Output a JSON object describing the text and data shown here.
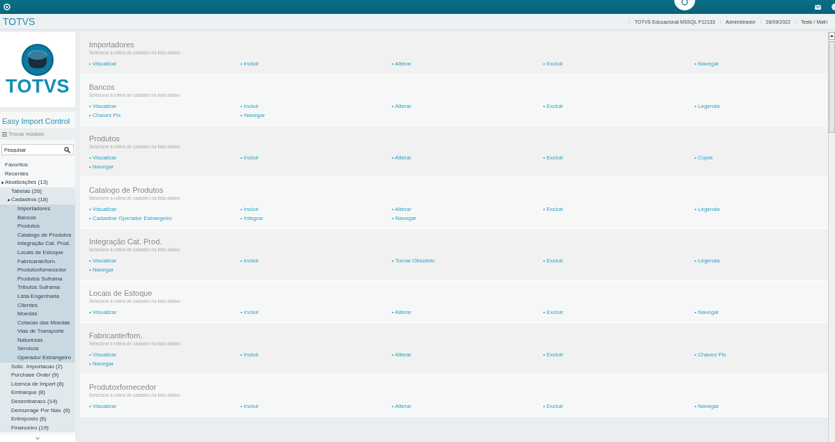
{
  "header": {
    "title": "TOTVS",
    "info": [
      "TOTVS Educacional MSSQL P12133",
      "Administrador",
      "26/09/2022",
      "Teste / Matri"
    ]
  },
  "sidebar": {
    "logo_text": "TOTVS",
    "module": "Easy Import Control",
    "switch_module": "Trocar módulo",
    "search": {
      "placeholder": "Pesquisar"
    },
    "tree": [
      {
        "label": "Favoritos"
      },
      {
        "label": "Recentes"
      },
      {
        "label": "Atualizações (13)",
        "expanded": true,
        "children": [
          {
            "label": "Tabelas (26)"
          },
          {
            "label": "Cadastros (18)",
            "expanded": true,
            "children": [
              {
                "label": "Importadores"
              },
              {
                "label": "Bancos"
              },
              {
                "label": "Produtos"
              },
              {
                "label": "Catalogo de Produtos"
              },
              {
                "label": "Integração Cat. Prod."
              },
              {
                "label": "Locais de Estoque"
              },
              {
                "label": "Fabricante/forn."
              },
              {
                "label": "Produtoxfornecedor"
              },
              {
                "label": "Produtos Suframa"
              },
              {
                "label": "Tributos Suframa"
              },
              {
                "label": "Lista Engenharia"
              },
              {
                "label": "Clientes"
              },
              {
                "label": "Moedas"
              },
              {
                "label": "Cotacao das Moedas"
              },
              {
                "label": "Vias de Transporte"
              },
              {
                "label": "Naturezas"
              },
              {
                "label": "Servicos"
              },
              {
                "label": "Operador Estrangeiro"
              }
            ]
          },
          {
            "label": "Solic. Importacao (2)"
          },
          {
            "label": "Purchase Order (9)"
          },
          {
            "label": "Licenca de Import (8)"
          },
          {
            "label": "Embarque (8)"
          },
          {
            "label": "Desembaraco (14)"
          },
          {
            "label": "Demurrage Por Nav. (6)"
          },
          {
            "label": "Entreposto (6)"
          },
          {
            "label": "Financeiro (19)"
          }
        ]
      }
    ]
  },
  "sections": [
    {
      "title": "Importadores",
      "subtitle": "Selecione a rotina de cadastro na lista abaixo",
      "links": [
        "• Visualizar",
        "• Incluir",
        "• Alterar",
        "• Excluir",
        "• Navegar"
      ]
    },
    {
      "title": "Bancos",
      "subtitle": "Selecione a rotina de cadastro na lista abaixo",
      "links": [
        "• Visualizar",
        "• Incluir",
        "• Alterar",
        "• Excluir",
        "• Legenda",
        "• Chaves Pix",
        "• Navegar"
      ]
    },
    {
      "title": "Produtos",
      "subtitle": "Selecione a rotina de cadastro na lista abaixo",
      "links": [
        "• Visualizar",
        "• Incluir",
        "• Alterar",
        "• Excluir",
        "• Copia",
        "• Navegar"
      ]
    },
    {
      "title": "Catalogo de Produtos",
      "subtitle": "Selecione a rotina de cadastro na lista abaixo",
      "links": [
        "• Visualizar",
        "• Incluir",
        "• Alterar",
        "• Excluir",
        "• Legenda",
        "• Cadastrar Operador Estrangeiro",
        "• Integrar",
        "• Navegar"
      ]
    },
    {
      "title": "Integração Cat. Prod.",
      "subtitle": "Selecione a rotina de cadastro na lista abaixo",
      "links": [
        "• Visualizar",
        "• Incluir",
        "• Tornar Obsoleto",
        "• Excluir",
        "• Legenda",
        "• Navegar"
      ]
    },
    {
      "title": "Locais de Estoque",
      "subtitle": "Selecione a rotina de cadastro na lista abaixo",
      "links": [
        "• Visualizar",
        "• Incluir",
        "• Alterar",
        "• Excluir",
        "• Navegar"
      ]
    },
    {
      "title": "Fabricante/forn.",
      "subtitle": "Selecione a rotina de cadastro na lista abaixo",
      "links": [
        "• Visualizar",
        "• Incluir",
        "• Alterar",
        "• Excluir",
        "• Chaves Pix",
        "• Navegar"
      ]
    },
    {
      "title": "Produtoxfornecedor",
      "subtitle": "Selecione a rotina de cadastro na lista abaixo",
      "links": [
        "• Visualizar",
        "• Incluir",
        "• Alterar",
        "• Excluir",
        "• Navegar"
      ]
    }
  ]
}
